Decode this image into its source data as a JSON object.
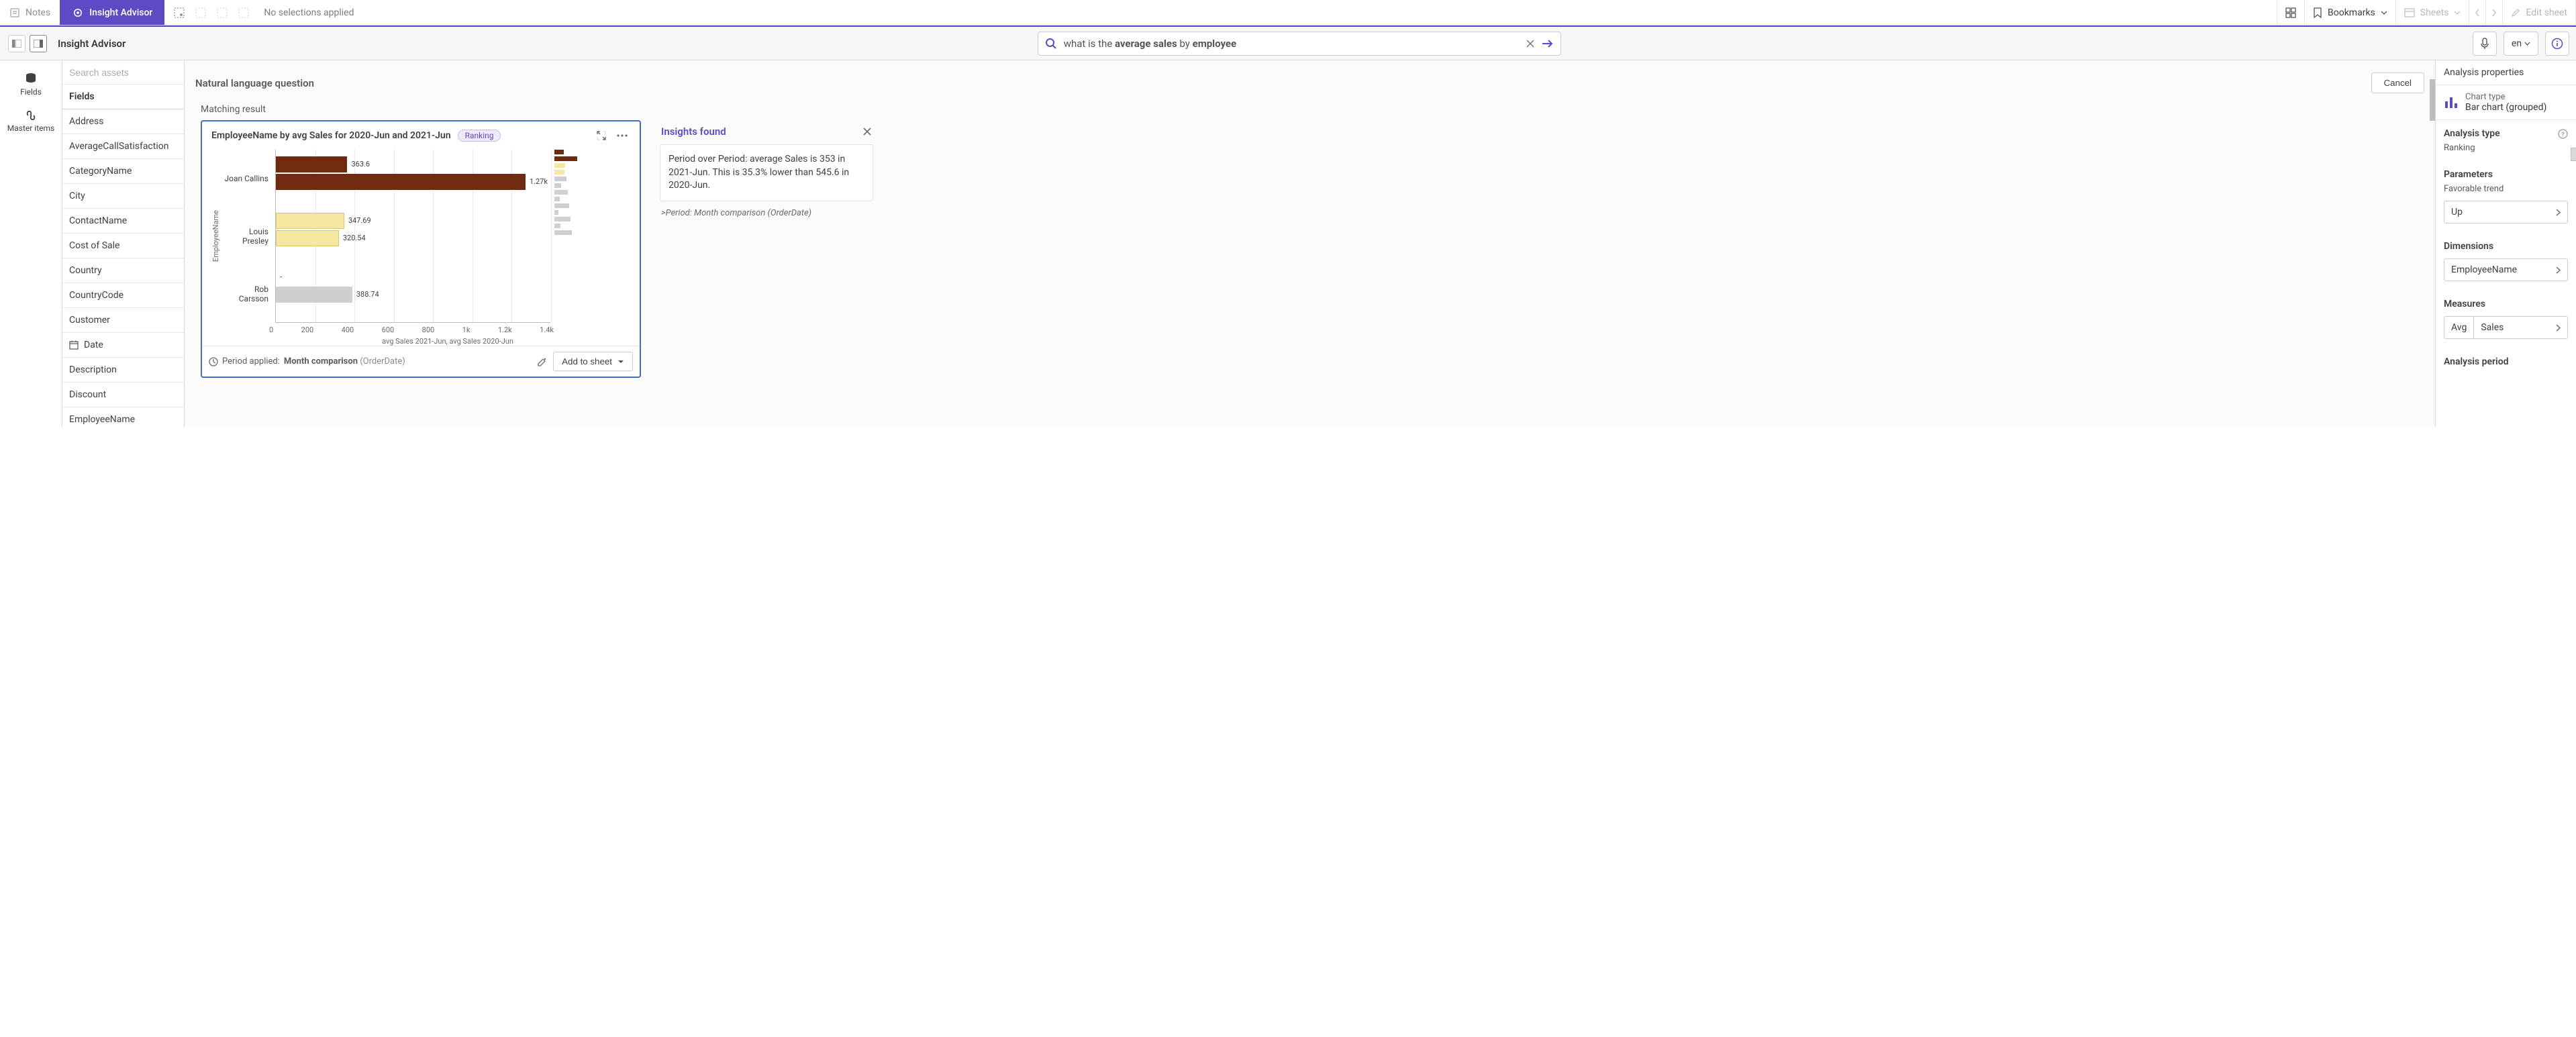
{
  "toolbar": {
    "notes": "Notes",
    "insightAdvisor": "Insight Advisor",
    "noSelections": "No selections applied",
    "bookmarks": "Bookmarks",
    "sheets": "Sheets",
    "editSheet": "Edit sheet"
  },
  "subbar": {
    "title": "Insight Advisor",
    "query_prefix": "what is the ",
    "query_bold1": "average sales",
    "query_mid": " by ",
    "query_bold2": "employee",
    "lang": "en"
  },
  "rail": {
    "fields": "Fields",
    "masterItems": "Master items"
  },
  "sidebar": {
    "searchPlaceholder": "Search assets",
    "fieldsHeader": "Fields",
    "items": [
      "Address",
      "AverageCallSatisfaction",
      "CategoryName",
      "City",
      "ContactName",
      "Cost of Sale",
      "Country",
      "CountryCode",
      "Customer",
      "Date",
      "Description",
      "Discount",
      "EmployeeName"
    ],
    "dateIcon": true
  },
  "nlq": {
    "label": "Natural language question",
    "cancel": "Cancel"
  },
  "matchingResult": "Matching result",
  "card": {
    "title": "EmployeeName by avg Sales for 2020-Jun and 2021-Jun",
    "tag": "Ranking",
    "ylabel": "EmployeeName",
    "xlabel": "avg Sales 2021-Jun, avg Sales 2020-Jun",
    "xticks": [
      "0",
      "200",
      "400",
      "600",
      "800",
      "1k",
      "1.2k",
      "1.4k"
    ],
    "period_applied_label": "Period applied:",
    "period_applied_value": "Month comparison",
    "period_applied_paren": "(OrderDate)",
    "addToSheet": "Add to sheet"
  },
  "chart_data": {
    "type": "bar",
    "orientation": "horizontal",
    "grouped": true,
    "categories": [
      "Joan Callins",
      "Louis Presley",
      "Rob Carsson"
    ],
    "series": [
      {
        "name": "avg Sales 2021-Jun",
        "color": "#7b2d0e",
        "values": [
          363.6,
          347.69,
          null
        ],
        "labels": [
          "363.6",
          "347.69",
          "-"
        ]
      },
      {
        "name": "avg Sales 2020-Jun",
        "color": "#7b2d0e",
        "values": [
          1270,
          320.54,
          388.74
        ],
        "labels": [
          "1.27k",
          "320.54",
          "388.74"
        ]
      }
    ],
    "series_colors_per_category": [
      [
        "#6f2a10",
        "#6f2a10"
      ],
      [
        "#f5e6a0",
        "#f5e6a0"
      ],
      [
        "#ffffff",
        "#cfcfcf"
      ]
    ],
    "xlim": [
      0,
      1400
    ],
    "title": "EmployeeName by avg Sales for 2020-Jun and 2021-Jun",
    "xlabel": "avg Sales 2021-Jun, avg Sales 2020-Jun",
    "ylabel": "EmployeeName"
  },
  "insights": {
    "header": "Insights found",
    "text": "Period over Period: average Sales is 353 in 2021-Jun. This is 35.3% lower than 545.6 in 2020-Jun.",
    "footnote": ">Period: Month comparison (OrderDate)"
  },
  "rpanel": {
    "analysisProperties": "Analysis properties",
    "chartTypeLabel": "Chart type",
    "chartTypeValue": "Bar chart (grouped)",
    "analysisType": "Analysis type",
    "analysisVal": "Ranking",
    "parameters": "Parameters",
    "favorableTrend": "Favorable trend",
    "favorableVal": "Up",
    "dimensions": "Dimensions",
    "dimensionVal": "EmployeeName",
    "measures": "Measures",
    "measureAgg": "Avg",
    "measureField": "Sales",
    "analysisPeriod": "Analysis period"
  }
}
